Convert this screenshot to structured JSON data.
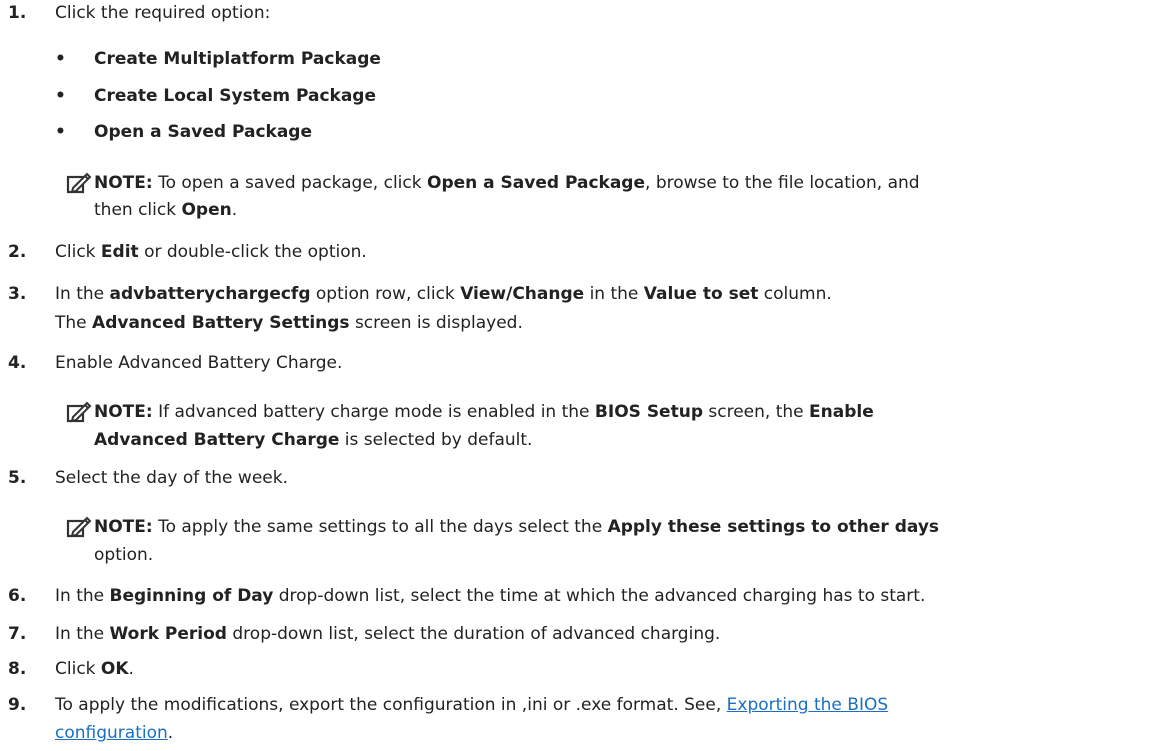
{
  "steps": [
    {
      "num": "1.",
      "parts": [
        {
          "t": "Click the required option:",
          "b": false
        }
      ]
    },
    {
      "bullets": [
        "Create Multiplatform Package",
        "Create Local System Package",
        "Open a Saved Package"
      ]
    },
    {
      "note": {
        "label": "NOTE:",
        "lines": [
          [
            {
              "t": " To open a saved package, click ",
              "b": false
            },
            {
              "t": "Open a Saved Package",
              "b": true
            },
            {
              "t": ", browse to the file location, and",
              "b": false
            }
          ],
          [
            {
              "t": "then click ",
              "b": false
            },
            {
              "t": "Open",
              "b": true
            },
            {
              "t": ".",
              "b": false
            }
          ]
        ]
      }
    },
    {
      "num": "2.",
      "parts": [
        {
          "t": "Click ",
          "b": false
        },
        {
          "t": "Edit",
          "b": true
        },
        {
          "t": " or double-click the option.",
          "b": false
        }
      ]
    },
    {
      "num": "3.",
      "parts": [
        {
          "t": "In the ",
          "b": false
        },
        {
          "t": "advbatterychargecfg",
          "b": true
        },
        {
          "t": " option row, click ",
          "b": false
        },
        {
          "t": "View/Change",
          "b": true
        },
        {
          "t": " in the ",
          "b": false
        },
        {
          "t": "Value to set",
          "b": true
        },
        {
          "t": " column.",
          "b": false
        }
      ]
    },
    {
      "cont": [
        {
          "t": "The ",
          "b": false
        },
        {
          "t": "Advanced Battery Settings",
          "b": true
        },
        {
          "t": " screen is displayed.",
          "b": false
        }
      ]
    },
    {
      "num": "4.",
      "parts": [
        {
          "t": "Enable Advanced Battery Charge.",
          "b": false
        }
      ]
    },
    {
      "note": {
        "label": "NOTE:",
        "lines": [
          [
            {
              "t": " If advanced battery charge mode is enabled in the ",
              "b": false
            },
            {
              "t": "BIOS Setup",
              "b": true
            },
            {
              "t": " screen, the ",
              "b": false
            },
            {
              "t": "Enable",
              "b": true
            }
          ],
          [
            {
              "t": "Advanced Battery Charge",
              "b": true
            },
            {
              "t": " is selected by default.",
              "b": false
            }
          ]
        ]
      }
    },
    {
      "num": "5.",
      "parts": [
        {
          "t": "Select the day of the week.",
          "b": false
        }
      ]
    },
    {
      "note": {
        "label": "NOTE:",
        "lines": [
          [
            {
              "t": " To apply the same settings to all the days select the ",
              "b": false
            },
            {
              "t": "Apply these settings to other days",
              "b": true
            }
          ],
          [
            {
              "t": "option.",
              "b": false
            }
          ]
        ]
      }
    },
    {
      "num": "6.",
      "parts": [
        {
          "t": "In the ",
          "b": false
        },
        {
          "t": "Beginning of Day",
          "b": true
        },
        {
          "t": " drop-down list, select the time at which the advanced charging has to start.",
          "b": false
        }
      ]
    },
    {
      "num": "7.",
      "parts": [
        {
          "t": "In the ",
          "b": false
        },
        {
          "t": "Work Period",
          "b": true
        },
        {
          "t": " drop-down list, select the duration of advanced charging.",
          "b": false
        }
      ]
    },
    {
      "num": "8.",
      "parts": [
        {
          "t": "Click ",
          "b": false
        },
        {
          "t": "OK",
          "b": true
        },
        {
          "t": ".",
          "b": false
        }
      ]
    },
    {
      "num": "9.",
      "parts": [
        {
          "t": "To apply the modifications, export the configuration in ,ini or .exe format. See, ",
          "b": false
        }
      ],
      "link": {
        "line1": "Exporting the BIOS",
        "line2": "configuration"
      },
      "after": "."
    }
  ],
  "icons": {
    "note": "pencil-note-icon"
  }
}
